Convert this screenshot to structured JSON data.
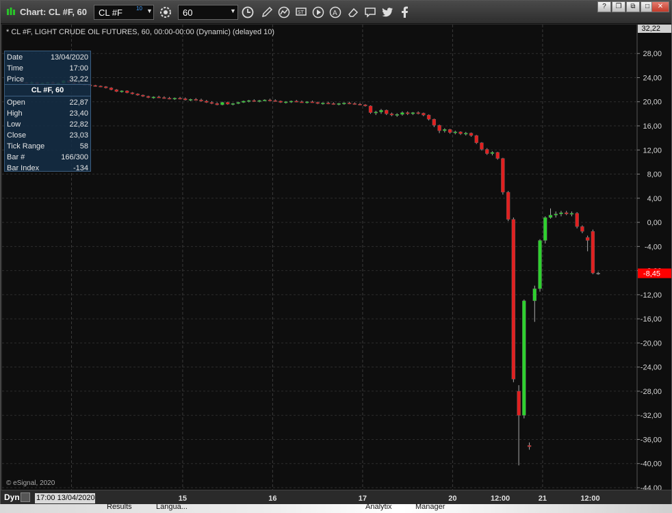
{
  "window": {
    "title": "Chart: CL #F, 60"
  },
  "toolbar": {
    "symbol": "CL #F",
    "symbol_superscript": "10",
    "interval": "60",
    "icons": [
      "settings-icon",
      "clock-icon",
      "pencil-icon",
      "line-draw-icon",
      "study-icon",
      "play-icon",
      "analyze-icon",
      "eraser-icon",
      "comment-icon",
      "twitter-icon",
      "facebook-icon"
    ]
  },
  "window_controls": {
    "help": "?",
    "restore": "❐",
    "link": "⧉",
    "minimize": "–",
    "maximize": "□",
    "close": "✕"
  },
  "chart_header": "* CL #F, LIGHT CRUDE OIL FUTURES, 60, 00:00-00:00 (Dynamic) (delayed 10)",
  "data_window": {
    "rows_top": [
      {
        "k": "Date",
        "v": "13/04/2020"
      },
      {
        "k": "Time",
        "v": "17:00"
      },
      {
        "k": "Price",
        "v": "32,22"
      }
    ],
    "title": "CL #F, 60",
    "rows_bottom": [
      {
        "k": "Open",
        "v": "22,87"
      },
      {
        "k": "High",
        "v": "23,40"
      },
      {
        "k": "Low",
        "v": "22,82"
      },
      {
        "k": "Close",
        "v": "23,03"
      },
      {
        "k": "Tick Range",
        "v": "58"
      },
      {
        "k": "Bar #",
        "v": "166/300"
      },
      {
        "k": "Bar Index",
        "v": "-134"
      }
    ]
  },
  "copyright": "© eSignal, 2020",
  "bottom": {
    "mode": "Dyn",
    "cursor_time": "17:00 13/04/2020",
    "xticks": [
      {
        "label": "15",
        "index": 31
      },
      {
        "label": "16",
        "index": 48
      },
      {
        "label": "17",
        "index": 65
      },
      {
        "label": "20",
        "index": 82
      },
      {
        "label": "12:00",
        "index": 91
      },
      {
        "label": "21",
        "index": 99
      },
      {
        "label": "12:00",
        "index": 108
      }
    ]
  },
  "taskbar": {
    "items": [
      "Results",
      "Langua...",
      "Analytix",
      "Manager"
    ]
  },
  "colors": {
    "up": "#2ed12e",
    "down": "#e02020",
    "neutral": "#8a8a8a",
    "last_price_bg": "#ff0000",
    "cursor_price_bg": "#d0d0d0"
  },
  "chart_data": {
    "type": "candlestick",
    "title": "CL #F, LIGHT CRUDE OIL FUTURES, 60",
    "ylim": [
      -44,
      32.22
    ],
    "yticks": [
      28,
      24,
      20,
      16,
      12,
      8,
      4,
      0,
      -4,
      -8,
      -12,
      -16,
      -20,
      -24,
      -28,
      -32,
      -36,
      -40,
      -44
    ],
    "ytick_labels": [
      "28,00",
      "24,00",
      "20,00",
      "16,00",
      "12,00",
      "8,00",
      "4,00",
      "0,00",
      "-4,00",
      "-8,00",
      "-12,00",
      "-16,00",
      "-20,00",
      "-24,00",
      "-28,00",
      "-32,00",
      "-36,00",
      "-40,00",
      "-44,00"
    ],
    "last_price": -8.45,
    "last_price_label": "-8,45",
    "cursor_price": 32.22,
    "cursor_price_label": "32,22",
    "session_dividers": [
      10,
      31,
      48,
      65,
      82,
      99
    ],
    "visible_ohlc": [
      [
        23.3,
        23.4,
        23.1,
        23.2
      ],
      [
        23.2,
        23.3,
        23.0,
        23.1
      ],
      [
        23.1,
        23.4,
        22.9,
        23.2
      ],
      [
        23.2,
        23.3,
        22.9,
        23.0
      ],
      [
        23.0,
        23.2,
        22.9,
        23.1
      ],
      [
        23.1,
        23.3,
        23.0,
        23.2
      ],
      [
        23.2,
        23.4,
        23.0,
        23.0
      ],
      [
        23.0,
        23.2,
        22.9,
        23.1
      ],
      [
        23.1,
        23.6,
        23.0,
        23.5
      ],
      [
        23.5,
        23.6,
        23.1,
        23.2
      ],
      [
        23.2,
        23.3,
        22.9,
        23.0
      ],
      [
        23.0,
        23.1,
        22.8,
        22.9
      ],
      [
        22.9,
        23.0,
        22.7,
        22.8
      ],
      [
        22.8,
        22.9,
        22.6,
        22.7
      ],
      [
        22.7,
        22.8,
        22.5,
        22.6
      ],
      [
        22.6,
        22.7,
        22.4,
        22.5
      ],
      [
        22.5,
        22.6,
        22.2,
        22.3
      ],
      [
        22.3,
        22.4,
        21.9,
        22.0
      ],
      [
        22.0,
        22.1,
        21.6,
        21.7
      ],
      [
        21.7,
        21.9,
        21.5,
        21.8
      ],
      [
        21.8,
        21.9,
        21.4,
        21.5
      ],
      [
        21.5,
        21.6,
        21.2,
        21.3
      ],
      [
        21.3,
        21.4,
        21.0,
        21.1
      ],
      [
        21.1,
        21.2,
        20.8,
        20.9
      ],
      [
        20.9,
        21.0,
        20.6,
        20.7
      ],
      [
        20.7,
        20.9,
        20.5,
        20.8
      ],
      [
        20.8,
        21.0,
        20.6,
        20.7
      ],
      [
        20.7,
        20.9,
        20.5,
        20.6
      ],
      [
        20.6,
        20.8,
        20.4,
        20.5
      ],
      [
        20.5,
        20.7,
        20.3,
        20.6
      ],
      [
        20.6,
        20.8,
        20.4,
        20.5
      ],
      [
        20.5,
        20.7,
        20.2,
        20.3
      ],
      [
        20.3,
        20.5,
        20.1,
        20.4
      ],
      [
        20.4,
        20.6,
        20.2,
        20.3
      ],
      [
        20.3,
        20.5,
        20.0,
        20.1
      ],
      [
        20.1,
        20.3,
        19.8,
        19.9
      ],
      [
        19.9,
        20.1,
        19.6,
        19.7
      ],
      [
        19.7,
        19.9,
        19.4,
        19.5
      ],
      [
        19.5,
        20.0,
        19.4,
        19.9
      ],
      [
        19.9,
        20.0,
        19.5,
        19.6
      ],
      [
        19.6,
        19.8,
        19.4,
        19.7
      ],
      [
        19.7,
        20.0,
        19.6,
        19.9
      ],
      [
        19.9,
        20.2,
        19.8,
        20.1
      ],
      [
        20.1,
        20.3,
        19.9,
        20.2
      ],
      [
        20.2,
        20.4,
        20.0,
        20.1
      ],
      [
        20.1,
        20.3,
        19.9,
        20.2
      ],
      [
        20.2,
        20.4,
        20.1,
        20.3
      ],
      [
        20.3,
        20.5,
        20.1,
        20.2
      ],
      [
        20.2,
        20.4,
        20.0,
        20.1
      ],
      [
        20.1,
        20.2,
        19.8,
        19.9
      ],
      [
        19.9,
        20.1,
        19.7,
        20.0
      ],
      [
        20.0,
        20.2,
        19.8,
        20.1
      ],
      [
        20.1,
        20.3,
        19.9,
        20.0
      ],
      [
        20.0,
        20.2,
        19.8,
        19.9
      ],
      [
        19.9,
        20.1,
        19.7,
        20.0
      ],
      [
        20.0,
        20.2,
        19.8,
        19.9
      ],
      [
        19.9,
        20.0,
        19.6,
        19.7
      ],
      [
        19.7,
        19.9,
        19.5,
        19.8
      ],
      [
        19.8,
        20.0,
        19.6,
        19.7
      ],
      [
        19.7,
        19.9,
        19.5,
        19.6
      ],
      [
        19.6,
        19.8,
        19.4,
        19.7
      ],
      [
        19.7,
        19.9,
        19.5,
        19.8
      ],
      [
        19.8,
        20.0,
        19.6,
        19.7
      ],
      [
        19.7,
        19.9,
        19.5,
        19.6
      ],
      [
        19.6,
        19.8,
        19.4,
        19.5
      ],
      [
        19.5,
        19.6,
        19.2,
        19.3
      ],
      [
        19.3,
        19.4,
        18.0,
        18.2
      ],
      [
        18.2,
        18.5,
        17.8,
        18.3
      ],
      [
        18.3,
        18.8,
        18.0,
        18.6
      ],
      [
        18.6,
        18.7,
        17.8,
        18.0
      ],
      [
        18.0,
        18.2,
        17.6,
        17.8
      ],
      [
        17.8,
        18.1,
        17.5,
        17.9
      ],
      [
        17.9,
        18.4,
        17.7,
        18.2
      ],
      [
        18.2,
        18.4,
        17.8,
        18.0
      ],
      [
        18.0,
        18.3,
        17.8,
        18.2
      ],
      [
        18.2,
        18.4,
        17.9,
        18.1
      ],
      [
        18.1,
        18.2,
        17.6,
        17.8
      ],
      [
        17.8,
        17.9,
        16.9,
        17.1
      ],
      [
        17.1,
        17.2,
        15.8,
        16.1
      ],
      [
        16.1,
        16.2,
        14.8,
        15.2
      ],
      [
        15.2,
        15.6,
        14.9,
        15.4
      ],
      [
        15.4,
        15.5,
        14.7,
        14.9
      ],
      [
        14.9,
        15.2,
        14.6,
        15.0
      ],
      [
        15.0,
        15.1,
        14.5,
        14.7
      ],
      [
        14.7,
        15.0,
        14.4,
        14.8
      ],
      [
        14.8,
        14.9,
        14.2,
        14.4
      ],
      [
        14.4,
        14.5,
        13.0,
        13.2
      ],
      [
        13.2,
        13.3,
        11.9,
        12.1
      ],
      [
        12.1,
        12.3,
        11.2,
        11.4
      ],
      [
        11.4,
        11.8,
        11.1,
        11.6
      ],
      [
        11.6,
        11.7,
        10.4,
        10.6
      ],
      [
        10.6,
        10.7,
        4.6,
        5.0
      ],
      [
        5.0,
        5.2,
        0.2,
        0.5
      ],
      [
        0.5,
        0.8,
        -26.5,
        -26.0
      ],
      [
        -28.0,
        -27.0,
        -40.3,
        -32.0
      ],
      [
        -32.0,
        -12.8,
        -32.5,
        -13.0
      ],
      [
        -37.0,
        -36.5,
        -37.7,
        -37.2
      ],
      [
        -13.0,
        -10.5,
        -16.5,
        -11.0
      ],
      [
        -11.0,
        -2.8,
        -11.5,
        -3.0
      ],
      [
        -3.0,
        1.0,
        -3.5,
        0.8
      ],
      [
        0.8,
        2.3,
        0.6,
        1.2
      ],
      [
        1.2,
        1.8,
        0.8,
        1.4
      ],
      [
        1.4,
        1.9,
        1.0,
        1.6
      ],
      [
        1.6,
        1.9,
        1.2,
        1.4
      ],
      [
        1.4,
        1.8,
        1.0,
        1.5
      ],
      [
        1.5,
        1.7,
        -1.0,
        -0.7
      ],
      [
        -0.7,
        -0.5,
        -1.8,
        -1.5
      ],
      [
        -2.5,
        -2.2,
        -4.8,
        -3.0
      ],
      [
        -1.5,
        -1.2,
        -8.6,
        -8.4
      ],
      [
        -8.4,
        -8.2,
        -8.7,
        -8.45
      ]
    ]
  }
}
